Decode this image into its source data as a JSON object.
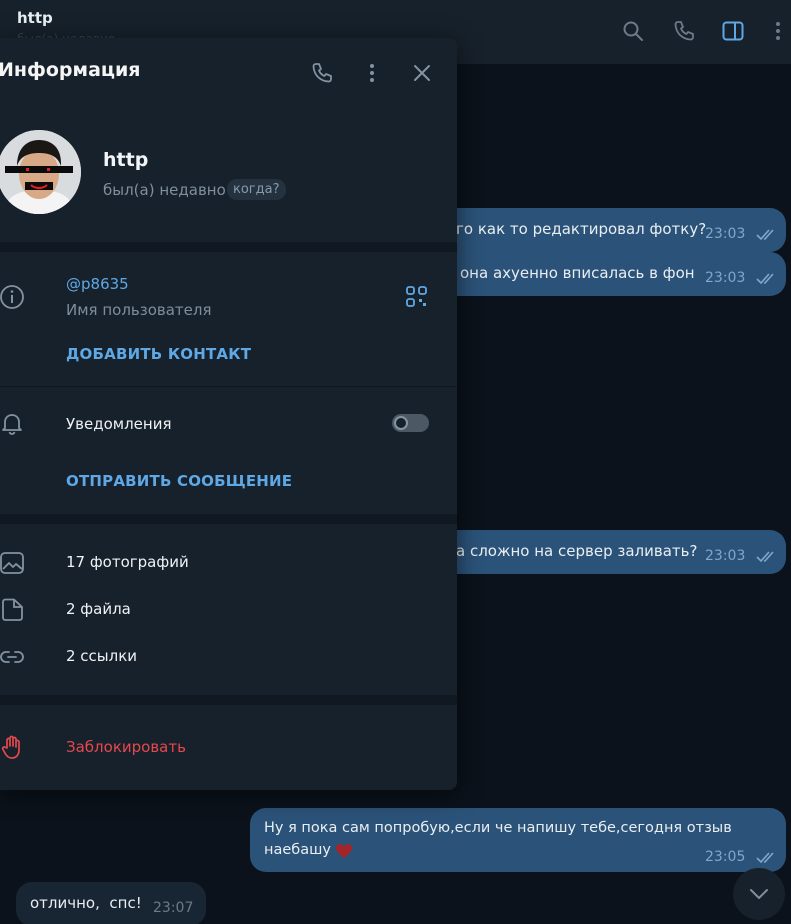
{
  "header": {
    "chat_title": "http",
    "chat_subtitle": "был(а) недавно"
  },
  "panel": {
    "title": "Информация",
    "profile": {
      "name": "http",
      "status": "был(а) недавно",
      "status_hint": "когда?"
    },
    "username": {
      "value": "@p8635",
      "label": "Имя пользователя"
    },
    "add_contact_label": "ДОБАВИТЬ КОНТАКТ",
    "notifications": {
      "label": "Уведомления",
      "enabled": false
    },
    "send_message_label": "ОТПРАВИТЬ СООБЩЕНИЕ",
    "media": {
      "photos": "17 фотографий",
      "files": "2 файла",
      "links": "2 ссылки"
    },
    "block_label": "Заблокировать"
  },
  "messages": [
    {
      "text": "го как то редактировал фотку?",
      "time": "23:03"
    },
    {
      "text": "она ахуенно вписалась в фон",
      "time": "23:03"
    },
    {
      "text": "а сложно на сервер заливать?",
      "time": "23:03"
    },
    {
      "text_line1": "Ну я пока сам попробую,если че напишу тебе,сегодня отзыв",
      "text_line2": "наебашу",
      "time": "23:05"
    },
    {
      "text": "отлично,  спс!",
      "time": "23:07"
    }
  ],
  "colors": {
    "accent": "#5fa8e6",
    "danger": "#e5484d",
    "outgoing_bubble": "#2b5278",
    "panel_bg": "#17212b"
  }
}
